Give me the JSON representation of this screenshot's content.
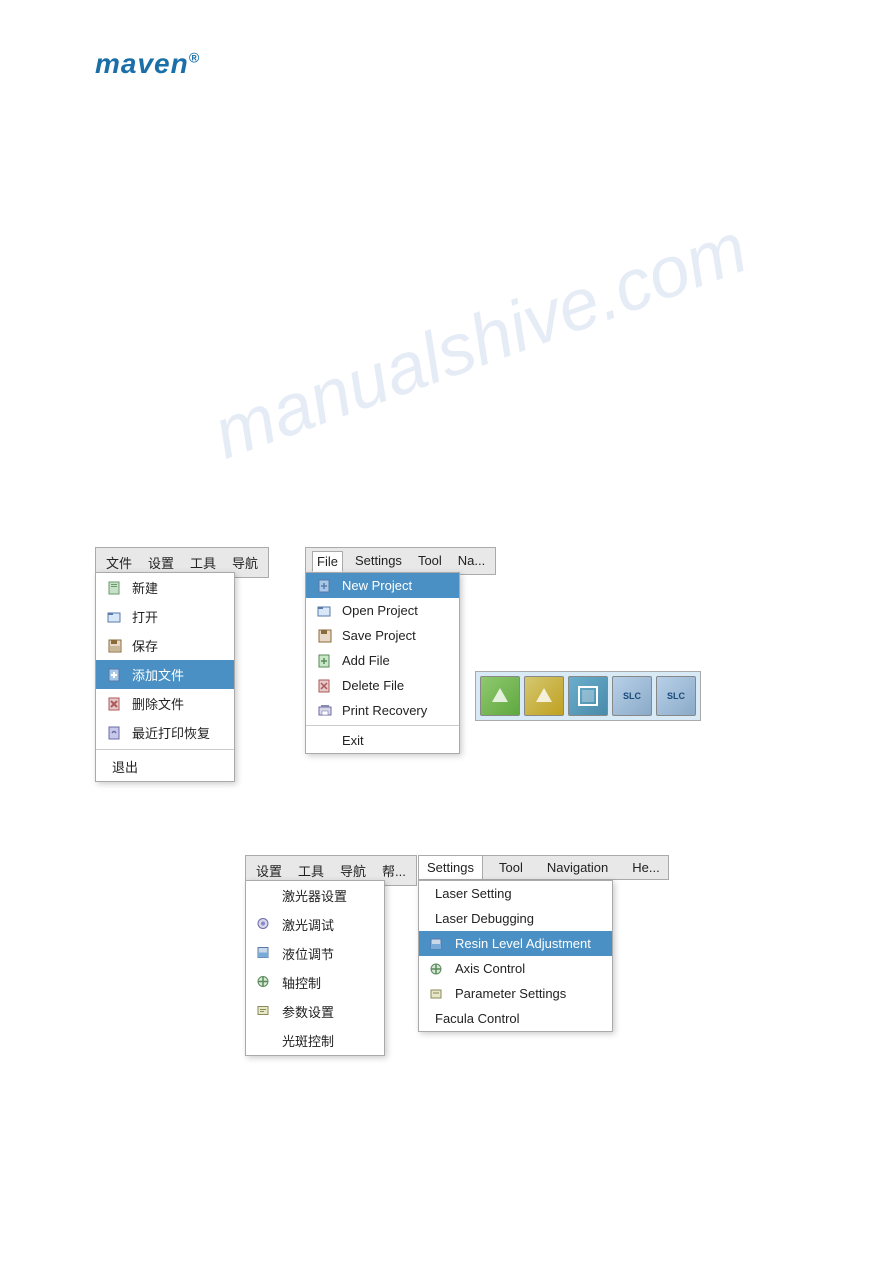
{
  "logo": {
    "text": "maven",
    "registered": "®"
  },
  "watermark": "manualshive.com",
  "top_section": {
    "cn_menubar": {
      "items": [
        "文件",
        "设置",
        "工具",
        "导航"
      ]
    },
    "cn_dropdown": {
      "items": [
        {
          "label": "新建",
          "icon": true,
          "active": false
        },
        {
          "label": "打开",
          "icon": true,
          "active": false
        },
        {
          "label": "保存",
          "icon": true,
          "active": false
        },
        {
          "label": "添加文件",
          "icon": true,
          "active": true
        },
        {
          "label": "删除文件",
          "icon": true,
          "active": false
        },
        {
          "label": "最近打印恢复",
          "icon": true,
          "active": false
        },
        {
          "separator": true
        },
        {
          "label": "退出",
          "icon": false,
          "active": false
        }
      ]
    },
    "en_menubar": {
      "items": [
        "File",
        "Settings",
        "Tool",
        "Na..."
      ]
    },
    "en_dropdown": {
      "items": [
        {
          "label": "New Project",
          "icon": true,
          "active": true
        },
        {
          "label": "Open Project",
          "icon": true,
          "active": false
        },
        {
          "label": "Save Project",
          "icon": true,
          "active": false
        },
        {
          "label": "Add File",
          "icon": true,
          "active": false
        },
        {
          "label": "Delete File",
          "icon": true,
          "active": false
        },
        {
          "label": "Print Recovery",
          "icon": true,
          "active": false
        },
        {
          "separator": true
        },
        {
          "label": "Exit",
          "icon": false,
          "active": false
        }
      ]
    },
    "toolbar_icons": [
      {
        "type": "green",
        "symbol": "▲"
      },
      {
        "type": "green2",
        "symbol": "▲"
      },
      {
        "type": "blue",
        "symbol": "□"
      },
      {
        "type": "slc",
        "symbol": "SLC"
      },
      {
        "type": "slc2",
        "symbol": "SLC"
      }
    ]
  },
  "bottom_section": {
    "cn_settings_menubar": {
      "items": [
        "设置",
        "工具",
        "导航",
        "帮..."
      ]
    },
    "cn_settings_dropdown": {
      "items": [
        {
          "label": "激光器设置",
          "icon": false
        },
        {
          "label": "激光调试",
          "icon": true
        },
        {
          "label": "液位调节",
          "icon": true
        },
        {
          "label": "轴控制",
          "icon": true
        },
        {
          "label": "参数设置",
          "icon": true
        },
        {
          "label": "光斑控制",
          "icon": false
        }
      ]
    },
    "en_settings_menubar": {
      "items": [
        "Settings",
        "Tool",
        "Navigation",
        "He..."
      ]
    },
    "en_settings_dropdown": {
      "items": [
        {
          "label": "Laser Setting",
          "icon": false,
          "active": false
        },
        {
          "label": "Laser Debugging",
          "icon": false,
          "active": false
        },
        {
          "label": "Resin Level Adjustment",
          "icon": true,
          "active": true
        },
        {
          "label": "Axis Control",
          "icon": true,
          "active": false
        },
        {
          "label": "Parameter Settings",
          "icon": true,
          "active": false
        },
        {
          "label": "Facula Control",
          "icon": false,
          "active": false
        }
      ]
    }
  }
}
